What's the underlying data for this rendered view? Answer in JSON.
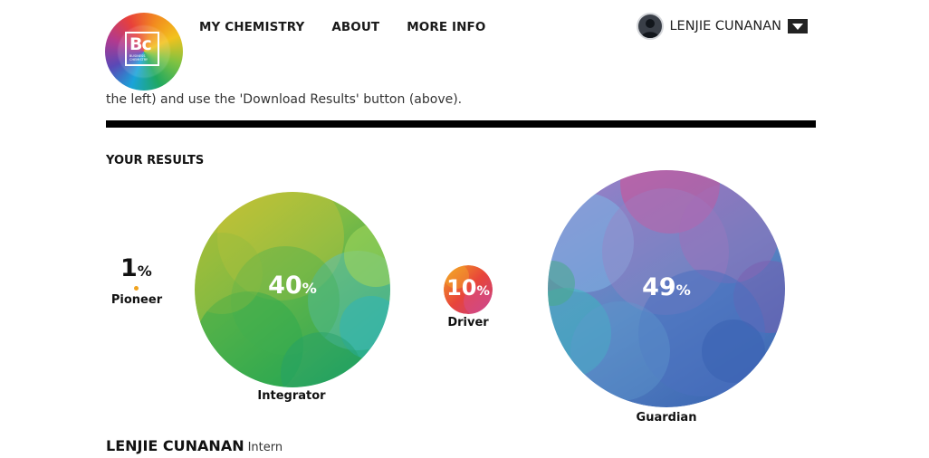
{
  "brand": {
    "logo_text": "Bc",
    "logo_subtext": "BUSINESS CHEMISTRY"
  },
  "nav": {
    "items": [
      "MY CHEMISTRY",
      "ABOUT",
      "MORE INFO"
    ]
  },
  "user": {
    "name": "LENJIE CUNANAN"
  },
  "intro_text": "the left) and use the 'Download Results' button (above).",
  "results": {
    "title": "YOUR RESULTS",
    "types": [
      {
        "name": "Pioneer",
        "percent": "1",
        "unit": "%",
        "color": "#f0a31e"
      },
      {
        "name": "Integrator",
        "percent": "40",
        "unit": "%",
        "color": "#3faa4a"
      },
      {
        "name": "Driver",
        "percent": "10",
        "unit": "%",
        "color": "#e5413a"
      },
      {
        "name": "Guardian",
        "percent": "49",
        "unit": "%",
        "color": "#4a6fbb"
      }
    ]
  },
  "profile": {
    "name": "LENJIE CUNANAN",
    "role": "Intern"
  }
}
